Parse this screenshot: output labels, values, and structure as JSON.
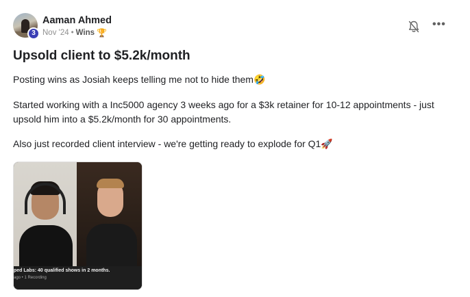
{
  "post": {
    "author": "Aaman Ahmed",
    "level": "3",
    "date": "Nov '24",
    "separator": "•",
    "category": "Wins",
    "category_icon": "trophy-icon",
    "title": "Upsold client to $5.2k/month",
    "paragraphs": [
      "Posting wins as Josiah keeps telling me not to hide them🤣",
      "Started working with a Inc5000 agency 3 weeks ago for a $3k retainer for 10-12 appointments - just upsold him into a $5.2k/month for 30 appointments.",
      "Also just recorded client interview - we're getting ready to explode for Q1🚀"
    ],
    "video": {
      "caption": "ped Labs: 40 qualified shows in 2 months.",
      "subcaption": "ago • 1 Recording"
    }
  },
  "actions": {
    "bell_icon": "bell-off-icon",
    "more_icon": "more-options-icon",
    "more_glyph": "•••"
  },
  "colors": {
    "level_badge": "#3b3fb6",
    "text_primary": "#202124",
    "text_muted": "#909090"
  }
}
